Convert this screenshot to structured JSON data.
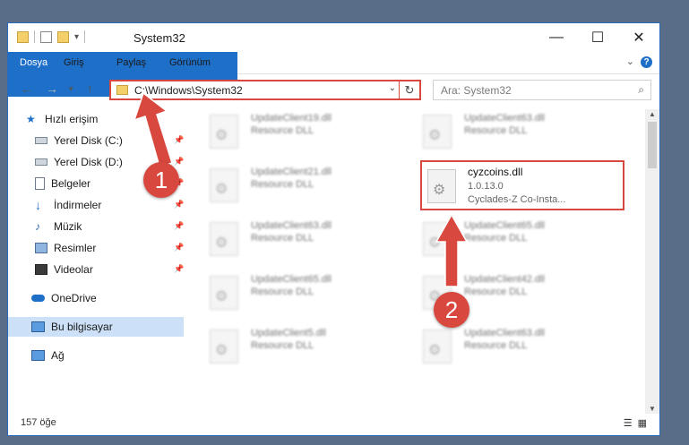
{
  "window": {
    "title": "System32"
  },
  "ribbon": {
    "tabs": [
      "Dosya",
      "Giriş",
      "Paylaş",
      "Görünüm"
    ]
  },
  "address": {
    "path": "C:\\Windows\\System32"
  },
  "search": {
    "placeholder": "Ara: System32"
  },
  "sidebar": {
    "items": [
      {
        "label": "Hızlı erişim",
        "icon": "star-icon"
      },
      {
        "label": "Yerel Disk (C:)",
        "icon": "drive-icon",
        "pinned": true
      },
      {
        "label": "Yerel Disk (D:)",
        "icon": "drive-icon",
        "pinned": true
      },
      {
        "label": "Belgeler",
        "icon": "documents-icon",
        "pinned": true
      },
      {
        "label": "İndirmeler",
        "icon": "download-icon",
        "pinned": true
      },
      {
        "label": "Müzik",
        "icon": "music-icon",
        "pinned": true
      },
      {
        "label": "Resimler",
        "icon": "pictures-icon",
        "pinned": true
      },
      {
        "label": "Videolar",
        "icon": "video-icon",
        "pinned": true
      },
      {
        "label": "OneDrive",
        "icon": "cloud-icon"
      },
      {
        "label": "Bu bilgisayar",
        "icon": "computer-icon",
        "selected": true
      },
      {
        "label": "Ağ",
        "icon": "network-icon"
      }
    ]
  },
  "files": [
    {
      "name": "UpdateClient19.dll",
      "type": "Resource DLL"
    },
    {
      "name": "UpdateClient63.dll",
      "type": "Resource DLL"
    },
    {
      "name": "UpdateClient21.dll",
      "type": "Resource DLL"
    },
    {
      "name": "cyzcoins.dll",
      "version": "1.0.13.0",
      "description": "Cyclades-Z Co-Insta..."
    },
    {
      "name": "UpdateClient63.dll",
      "type": "Resource DLL"
    },
    {
      "name": "UpdateClient65.dll",
      "type": "Resource DLL"
    },
    {
      "name": "UpdateClient65.dll",
      "type": "Resource DLL"
    },
    {
      "name": "UpdateClient42.dll",
      "type": "Resource DLL"
    },
    {
      "name": "UpdateClient5.dll",
      "type": "Resource DLL"
    },
    {
      "name": "UpdateClient63.dll",
      "type": "Resource DLL"
    }
  ],
  "status": {
    "count": "157 öğe"
  },
  "annotations": {
    "step1": "1",
    "step2": "2"
  },
  "colors": {
    "accent": "#1e6fc8",
    "highlight": "#d9483e"
  }
}
